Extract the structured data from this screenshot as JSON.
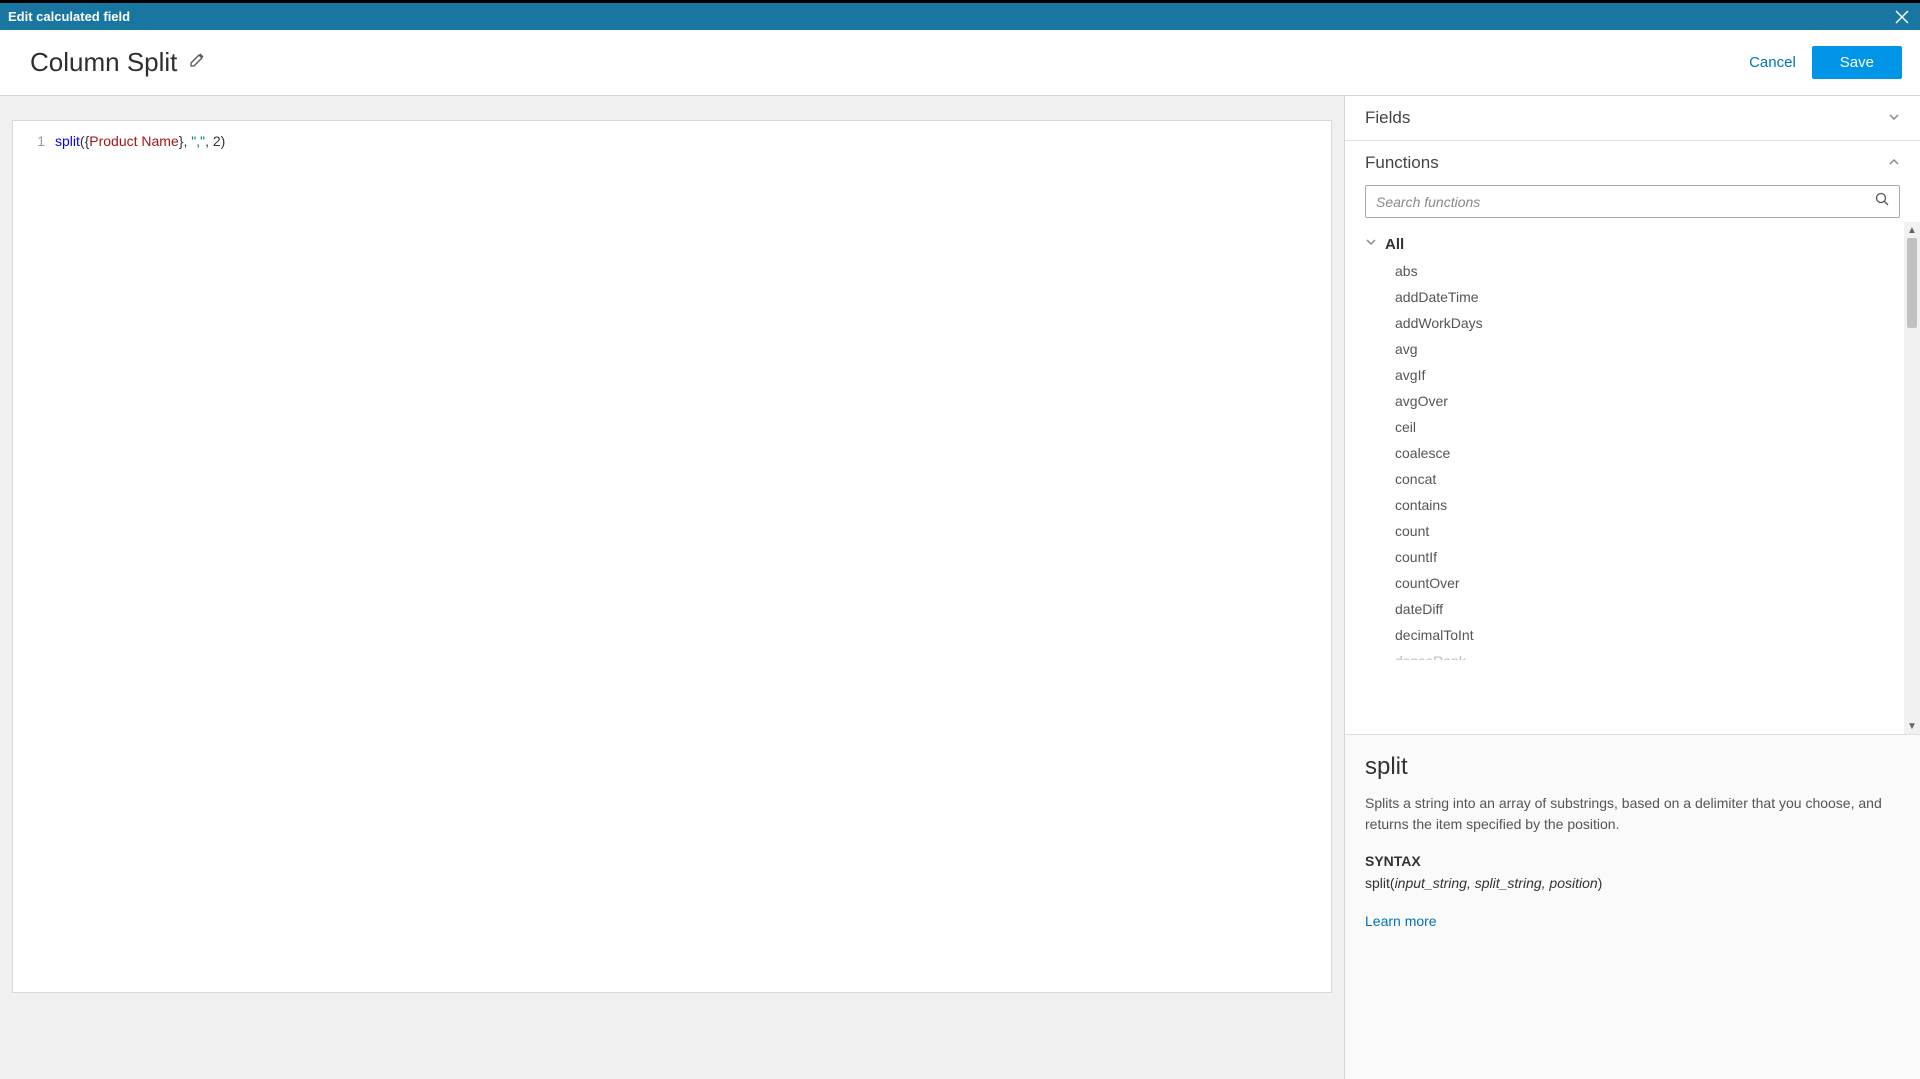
{
  "titleBar": {
    "title": "Edit calculated field"
  },
  "header": {
    "fieldName": "Column Split",
    "cancel": "Cancel",
    "save": "Save"
  },
  "editor": {
    "lineNumber": "1",
    "tokens": {
      "fn": "split",
      "open": "(",
      "braceOpen": "{",
      "field": "Product Name",
      "braceClose": "}",
      "comma1": ", ",
      "strQuote1": "\"",
      "strContent": ",",
      "strQuote2": "\"",
      "comma2": ", ",
      "num": "2",
      "close": ")"
    }
  },
  "sidePanel": {
    "fieldsLabel": "Fields",
    "functionsLabel": "Functions",
    "searchPlaceholder": "Search functions",
    "groupLabel": "All",
    "functions": [
      "abs",
      "addDateTime",
      "addWorkDays",
      "avg",
      "avgIf",
      "avgOver",
      "ceil",
      "coalesce",
      "concat",
      "contains",
      "count",
      "countIf",
      "countOver",
      "dateDiff",
      "decimalToInt",
      "denseRank"
    ]
  },
  "doc": {
    "title": "split",
    "description": "Splits a string into an array of substrings, based on a delimiter that you choose, and returns the item specified by the position.",
    "syntaxLabel": "SYNTAX",
    "syntaxFn": "split(",
    "syntaxParams": "input_string, split_string, position",
    "syntaxClose": ")",
    "learnMore": "Learn more"
  }
}
